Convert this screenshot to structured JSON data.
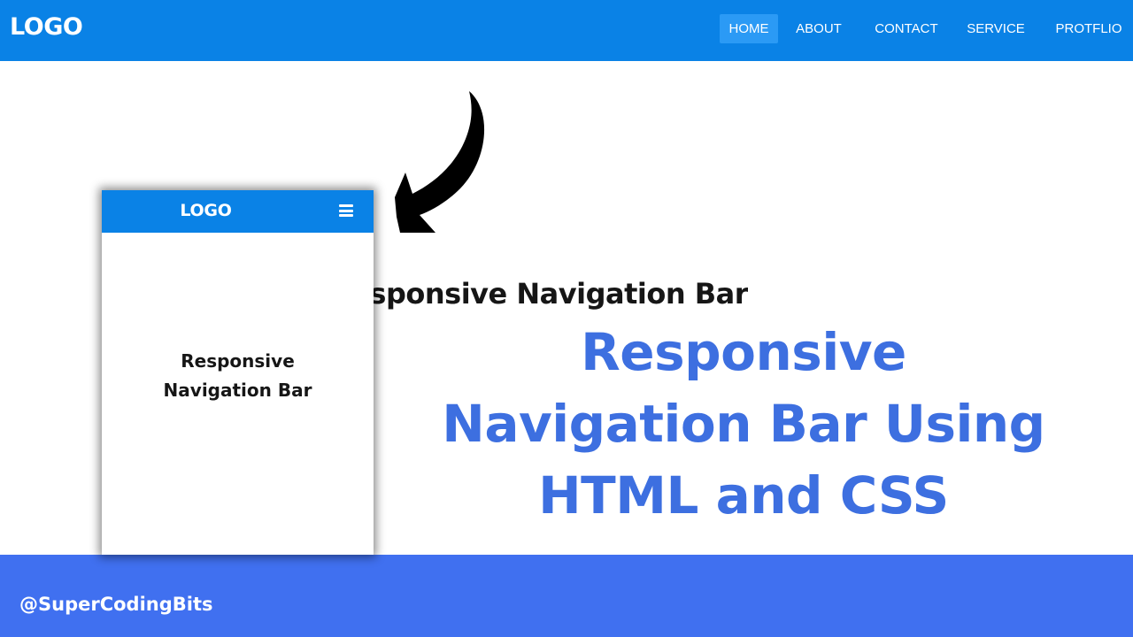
{
  "navbar": {
    "logo": "LOGO",
    "links": [
      "HOME",
      "ABOUT",
      "CONTACT",
      "SERVICE",
      "PROTFLIO"
    ],
    "active_index": 0
  },
  "page_heading": "Responsive Navigation Bar",
  "mobile": {
    "logo": "LOGO",
    "menu_icon": "hamburger-icon",
    "heading_line1": "Responsive",
    "heading_line2": "Navigation Bar"
  },
  "title": {
    "line1": "Responsive",
    "line2": "Navigation Bar Using",
    "line3": "HTML and CSS"
  },
  "footer": {
    "handle": "@SuperCodingBits"
  },
  "colors": {
    "nav_blue": "#0a82e6",
    "active_link": "#2b9af5",
    "title_blue": "#3d6fe0",
    "footer_blue": "#4070f0"
  }
}
